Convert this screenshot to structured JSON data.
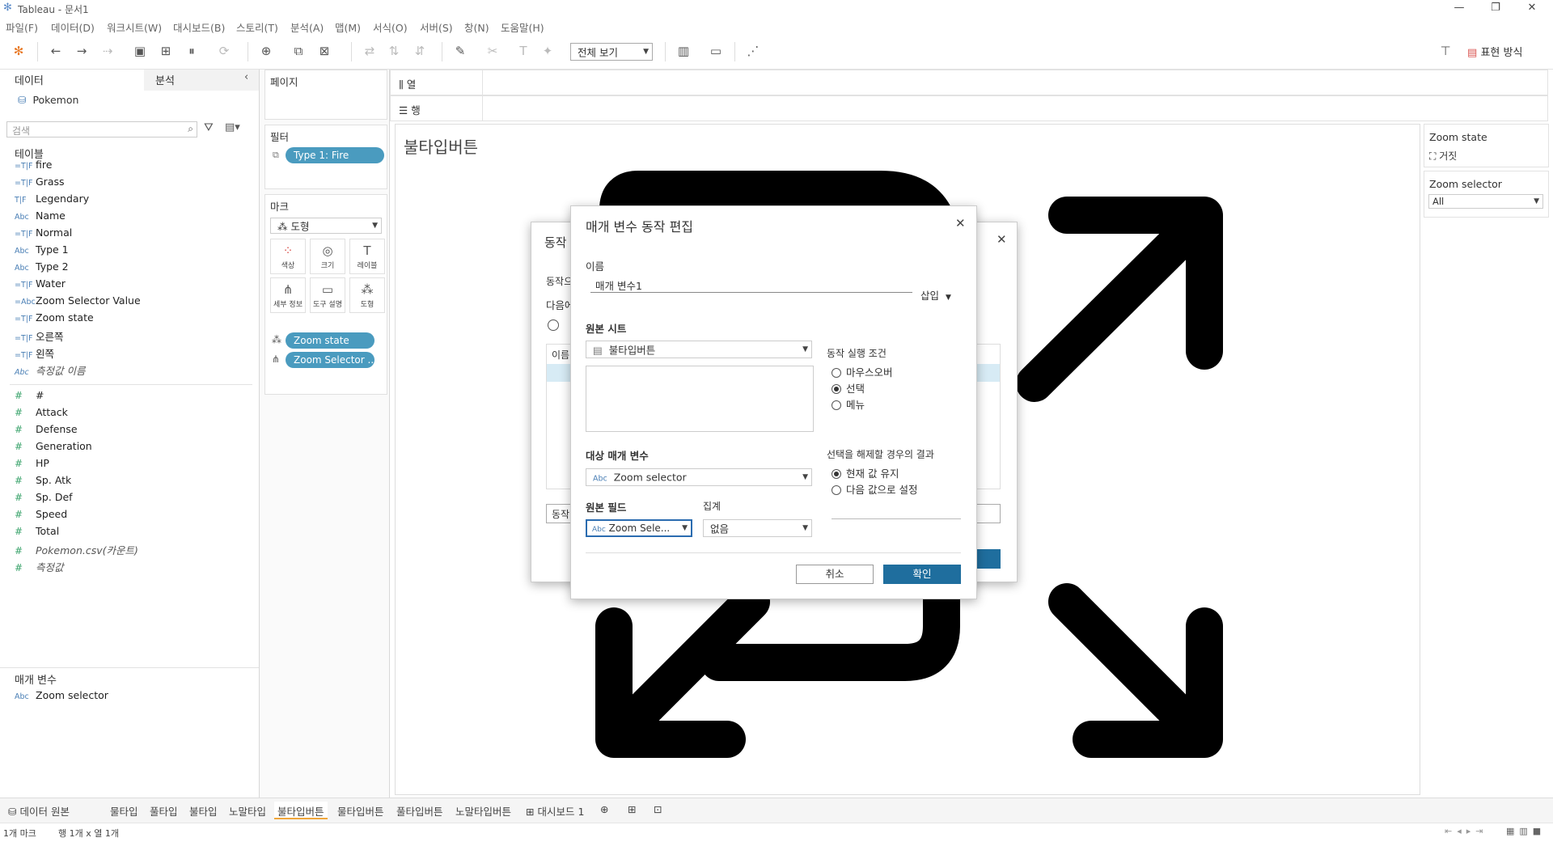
{
  "window": {
    "title": "Tableau - 문서1",
    "min": "—",
    "restore": "❐",
    "close": "✕"
  },
  "menu": [
    "파일(F)",
    "데이터(D)",
    "워크시트(W)",
    "대시보드(B)",
    "스토리(T)",
    "분석(A)",
    "맵(M)",
    "서식(O)",
    "서버(S)",
    "창(N)",
    "도움말(H)"
  ],
  "toolbar": {
    "view_select": "전체 보기",
    "show_me": "표현 방식"
  },
  "left": {
    "tab_data": "데이터",
    "tab_analysis": "분석",
    "datasource": "Pokemon",
    "search_placeholder": "검색",
    "tables_header": "테이블",
    "dimensions": [
      {
        "icon": "=T|F",
        "name": "fire"
      },
      {
        "icon": "=T|F",
        "name": "Grass"
      },
      {
        "icon": "T|F",
        "name": "Legendary"
      },
      {
        "icon": "Abc",
        "name": "Name"
      },
      {
        "icon": "=T|F",
        "name": "Normal"
      },
      {
        "icon": "Abc",
        "name": "Type 1"
      },
      {
        "icon": "Abc",
        "name": "Type 2"
      },
      {
        "icon": "=T|F",
        "name": "Water"
      },
      {
        "icon": "=Abc",
        "name": "Zoom Selector Value"
      },
      {
        "icon": "=T|F",
        "name": "Zoom state"
      },
      {
        "icon": "=T|F",
        "name": "오른쪽"
      },
      {
        "icon": "=T|F",
        "name": "왼쪽"
      },
      {
        "icon": "Abc",
        "name": "측정값 이름",
        "italic": true
      }
    ],
    "measures": [
      {
        "name": "#"
      },
      {
        "name": "Attack"
      },
      {
        "name": "Defense"
      },
      {
        "name": "Generation"
      },
      {
        "name": "HP"
      },
      {
        "name": "Sp. Atk"
      },
      {
        "name": "Sp. Def"
      },
      {
        "name": "Speed"
      },
      {
        "name": "Total"
      },
      {
        "name": "Pokemon.csv(카운트)",
        "italic": true
      },
      {
        "name": "측정값",
        "italic": true
      }
    ],
    "params_header": "매개 변수",
    "params": [
      {
        "icon": "Abc",
        "name": "Zoom selector"
      }
    ]
  },
  "shelves": {
    "pages": "페이지",
    "filters": "필터",
    "filter_pill": "Type 1: Fire",
    "marks": "마크",
    "mark_type": "도형",
    "mark_buttons": [
      "색상",
      "크기",
      "레이블",
      "세부 정보",
      "도구 설명",
      "도형"
    ],
    "mark_pills": [
      "Zoom state",
      "Zoom Selector .."
    ],
    "columns": "열",
    "rows": "행"
  },
  "viz": {
    "title": "불타입버튼"
  },
  "right": {
    "zoom_state_title": "Zoom state",
    "zoom_state_value": "거짓",
    "zoom_selector_title": "Zoom selector",
    "zoom_selector_value": "All"
  },
  "back_dialog": {
    "title": "동작",
    "line1": "동작으",
    "line2": "다음에",
    "col": "이름",
    "btn_stub": "동작"
  },
  "dialog": {
    "title": "매개 변수 동작 편집",
    "name_label": "이름",
    "name_value": "매개 변수1",
    "insert": "삽입",
    "source_sheet_label": "원본 시트",
    "source_sheet": "불타입버튼",
    "run_on_label": "동작 실행 조건",
    "run_on": [
      "마우스오버",
      "선택",
      "메뉴"
    ],
    "run_on_selected": 1,
    "target_param_label": "대상 매개 변수",
    "target_param": "Zoom selector",
    "clear_label": "선택을 해제할 경우의 결과",
    "clear_options": [
      "현재 값 유지",
      "다음 값으로 설정"
    ],
    "clear_selected": 0,
    "source_field_label": "원본 필드",
    "source_field": "Zoom Sele...",
    "aggregation_label": "집계",
    "aggregation": "없음",
    "cancel": "취소",
    "ok": "확인"
  },
  "tabs": [
    "데이터 원본",
    "물타입",
    "풀타입",
    "불타입",
    "노말타입",
    "불타입버튼",
    "물타입버튼",
    "풀타입버튼",
    "노말타입버튼",
    "대시보드 1"
  ],
  "active_tab": 5,
  "status": {
    "marks": "1개 마크",
    "rowcol": "행 1개 x 열 1개"
  }
}
